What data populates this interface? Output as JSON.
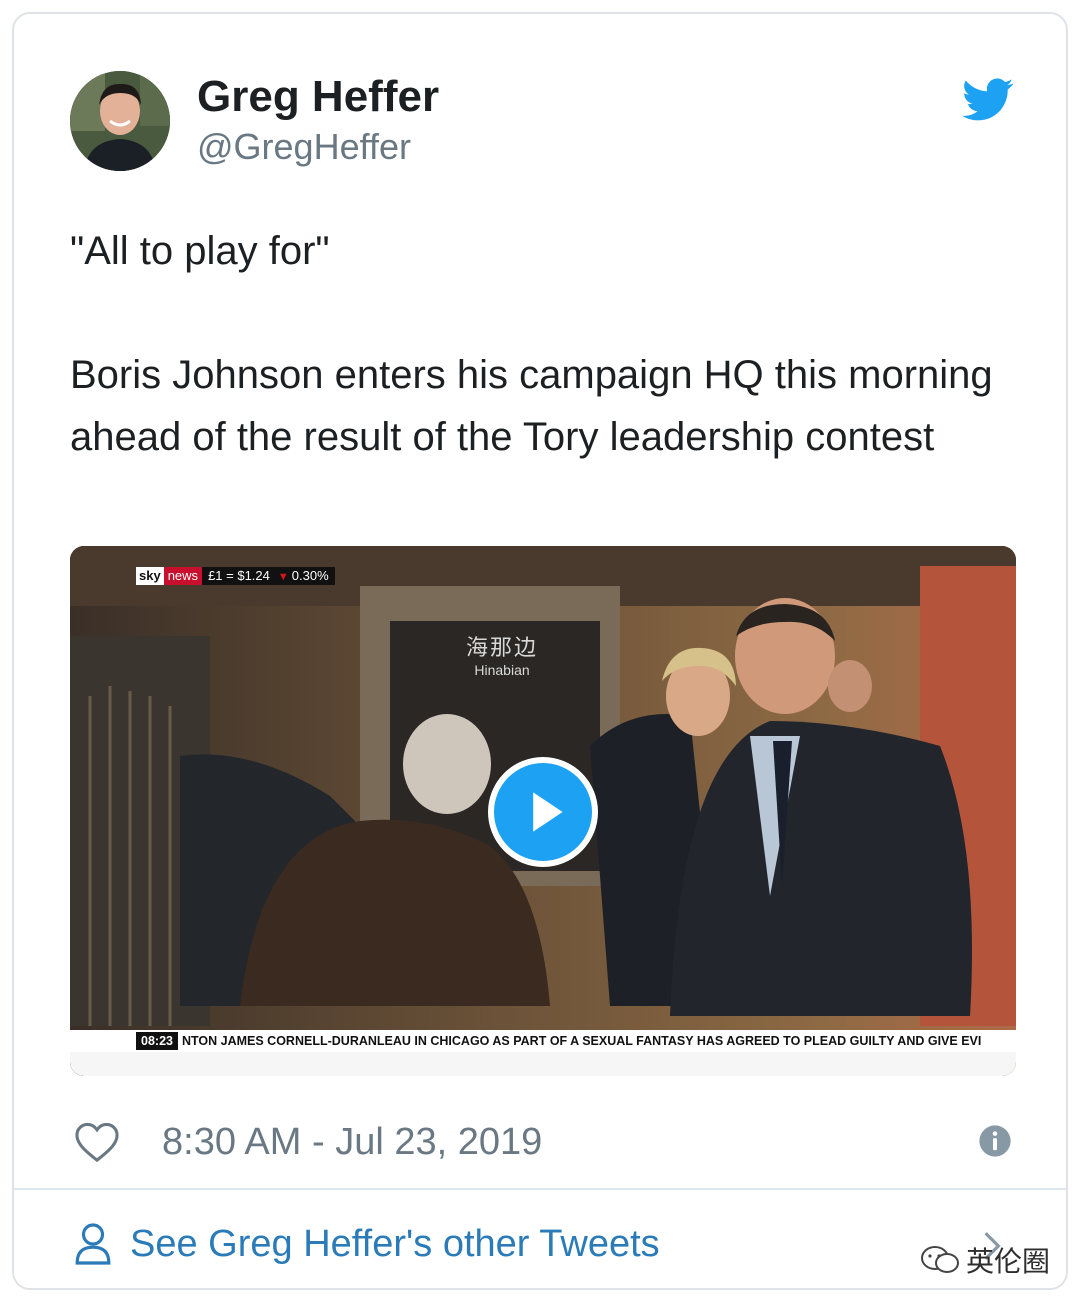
{
  "author": {
    "name": "Greg Heffer",
    "handle": "@GregHeffer",
    "avatar_icon": "avatar",
    "brand_icon": "twitter-bird-icon",
    "brand_color": "#1da1f2"
  },
  "tweet": {
    "line1": "\"All to play for\"",
    "line2": "Boris Johnson enters his campaign HQ this morning ahead of the result of the Tory leadership contest"
  },
  "video": {
    "channel_sky": "sky",
    "channel_news": "news",
    "fx_rate": "£1 = $1.24",
    "fx_change": "0.30%",
    "watermark_cn": "海那边",
    "watermark_en": "Hinabian",
    "clock": "08:23",
    "crawl_text": "NTON JAMES CORNELL-DURANLEAU IN CHICAGO AS PART OF A SEXUAL FANTASY HAS AGREED TO PLEAD GUILTY AND GIVE EVI",
    "play_icon": "play-icon"
  },
  "meta": {
    "like_icon": "heart-icon",
    "timestamp": "8:30 AM - Jul 23, 2019",
    "info_icon": "info-icon"
  },
  "footer": {
    "see_more": "See Greg Heffer's other Tweets",
    "person_icon": "person-icon",
    "chevron_icon": "chevron-right-icon",
    "wechat_label": "英伦圈",
    "link_color": "#2b7bb9"
  }
}
